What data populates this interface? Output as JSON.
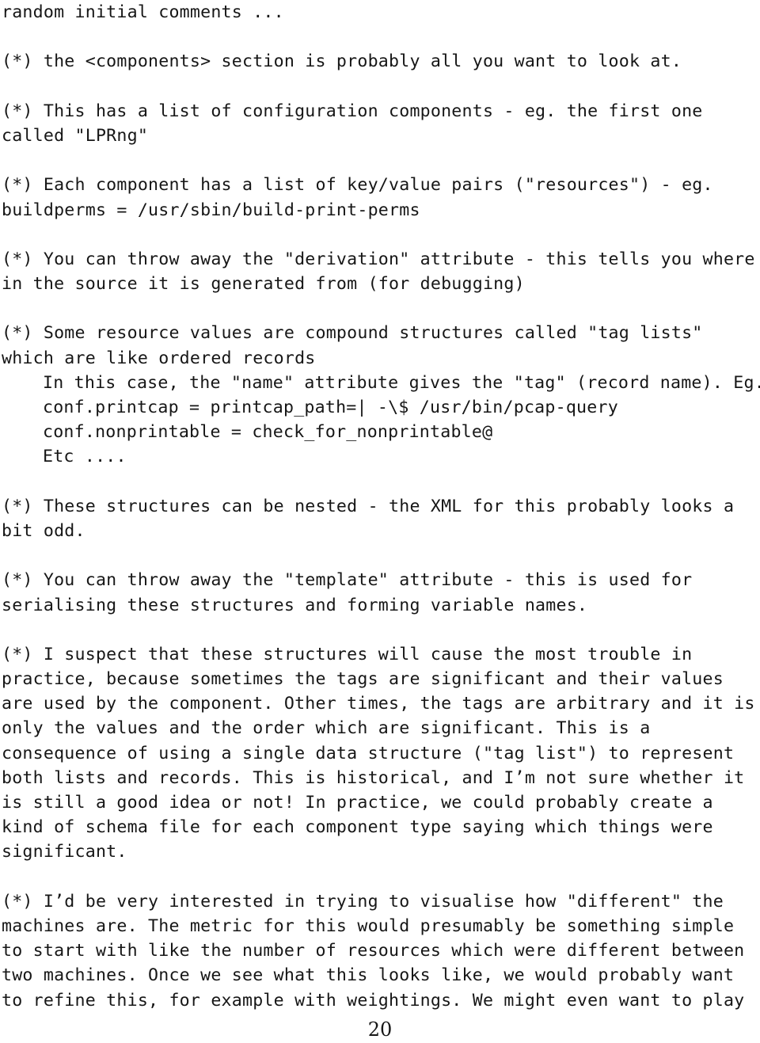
{
  "document": {
    "page_number": "20",
    "text_color": "#161616",
    "background_color": "#ffffff",
    "lines": [
      {
        "text": "random initial comments ...",
        "indent": false
      },
      {
        "text": "",
        "indent": false
      },
      {
        "text": "(*) the <components> section is probably all you want to look at.",
        "indent": false
      },
      {
        "text": "",
        "indent": false
      },
      {
        "text": "(*) This has a list of configuration components - eg. the first one",
        "indent": false
      },
      {
        "text": "called \"LPRng\"",
        "indent": false
      },
      {
        "text": "",
        "indent": false
      },
      {
        "text": "(*) Each component has a list of key/value pairs (\"resources\") - eg.",
        "indent": false
      },
      {
        "text": "buildperms = /usr/sbin/build-print-perms",
        "indent": false
      },
      {
        "text": "",
        "indent": false
      },
      {
        "text": "(*) You can throw away the \"derivation\" attribute - this tells you where",
        "indent": false
      },
      {
        "text": "in the source it is generated from (for debugging)",
        "indent": false
      },
      {
        "text": "",
        "indent": false
      },
      {
        "text": "(*) Some resource values are compound structures called \"tag lists\"",
        "indent": false
      },
      {
        "text": "which are like ordered records",
        "indent": false
      },
      {
        "text": "In this case, the \"name\" attribute gives the \"tag\" (record name). Eg.",
        "indent": true
      },
      {
        "text": "conf.printcap = printcap_path=| -\\$ /usr/bin/pcap-query",
        "indent": true
      },
      {
        "text": "conf.nonprintable = check_for_nonprintable@",
        "indent": true
      },
      {
        "text": "Etc ....",
        "indent": true
      },
      {
        "text": "",
        "indent": false
      },
      {
        "text": "(*) These structures can be nested - the XML for this probably looks a",
        "indent": false
      },
      {
        "text": "bit odd.",
        "indent": false
      },
      {
        "text": "",
        "indent": false
      },
      {
        "text": "(*) You can throw away the \"template\" attribute - this is used for",
        "indent": false
      },
      {
        "text": "serialising these structures and forming variable names.",
        "indent": false
      },
      {
        "text": "",
        "indent": false
      },
      {
        "text": "(*) I suspect that these structures will cause the most trouble in",
        "indent": false
      },
      {
        "text": "practice, because sometimes the tags are significant and their values",
        "indent": false
      },
      {
        "text": "are used by the component. Other times, the tags are arbitrary and it is",
        "indent": false
      },
      {
        "text": "only the values and the order which are significant. This is a",
        "indent": false
      },
      {
        "text": "consequence of using a single data structure (\"tag list\") to represent",
        "indent": false
      },
      {
        "text": "both lists and records. This is historical, and I’m not sure whether it",
        "indent": false
      },
      {
        "text": "is still a good idea or not! In practice, we could probably create a",
        "indent": false
      },
      {
        "text": "kind of schema file for each component type saying which things were",
        "indent": false
      },
      {
        "text": "significant.",
        "indent": false
      },
      {
        "text": "",
        "indent": false
      },
      {
        "text": "(*) I’d be very interested in trying to visualise how \"different\" the",
        "indent": false
      },
      {
        "text": "machines are. The metric for this would presumably be something simple",
        "indent": false
      },
      {
        "text": "to start with like the number of resources which were different between",
        "indent": false
      },
      {
        "text": "two machines. Once we see what this looks like, we would probably want",
        "indent": false
      },
      {
        "text": "to refine this, for example with weightings. We might even want to play",
        "indent": false
      }
    ]
  }
}
